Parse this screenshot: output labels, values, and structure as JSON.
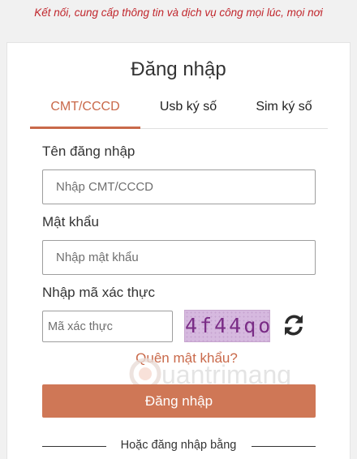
{
  "header": {
    "tagline": "Kết nối, cung cấp thông tin và dịch vụ công mọi lúc, mọi nơi"
  },
  "login": {
    "title": "Đăng nhập",
    "tabs": [
      {
        "label": "CMT/CCCD",
        "active": true
      },
      {
        "label": "Usb ký số",
        "active": false
      },
      {
        "label": "Sim ký số",
        "active": false
      }
    ],
    "username": {
      "label": "Tên đăng nhập",
      "placeholder": "Nhập CMT/CCCD",
      "value": ""
    },
    "password": {
      "label": "Mật khẩu",
      "placeholder": "Nhập mật khẩu",
      "value": ""
    },
    "captcha": {
      "label": "Nhập mã xác thực",
      "placeholder": "Mã xác thực",
      "code": "4f44qo",
      "refresh_icon": "refresh-icon"
    },
    "forgot_password": "Quên mật khẩu?",
    "submit_label": "Đăng nhập",
    "alternative_label": "Hoặc đăng nhập bằng"
  },
  "watermark": {
    "text": "uantrimang"
  },
  "colors": {
    "accent": "#cf7756",
    "tagline": "#c1272d",
    "tab_active": "#c9694a",
    "captcha_bg": "#d6b9df"
  }
}
